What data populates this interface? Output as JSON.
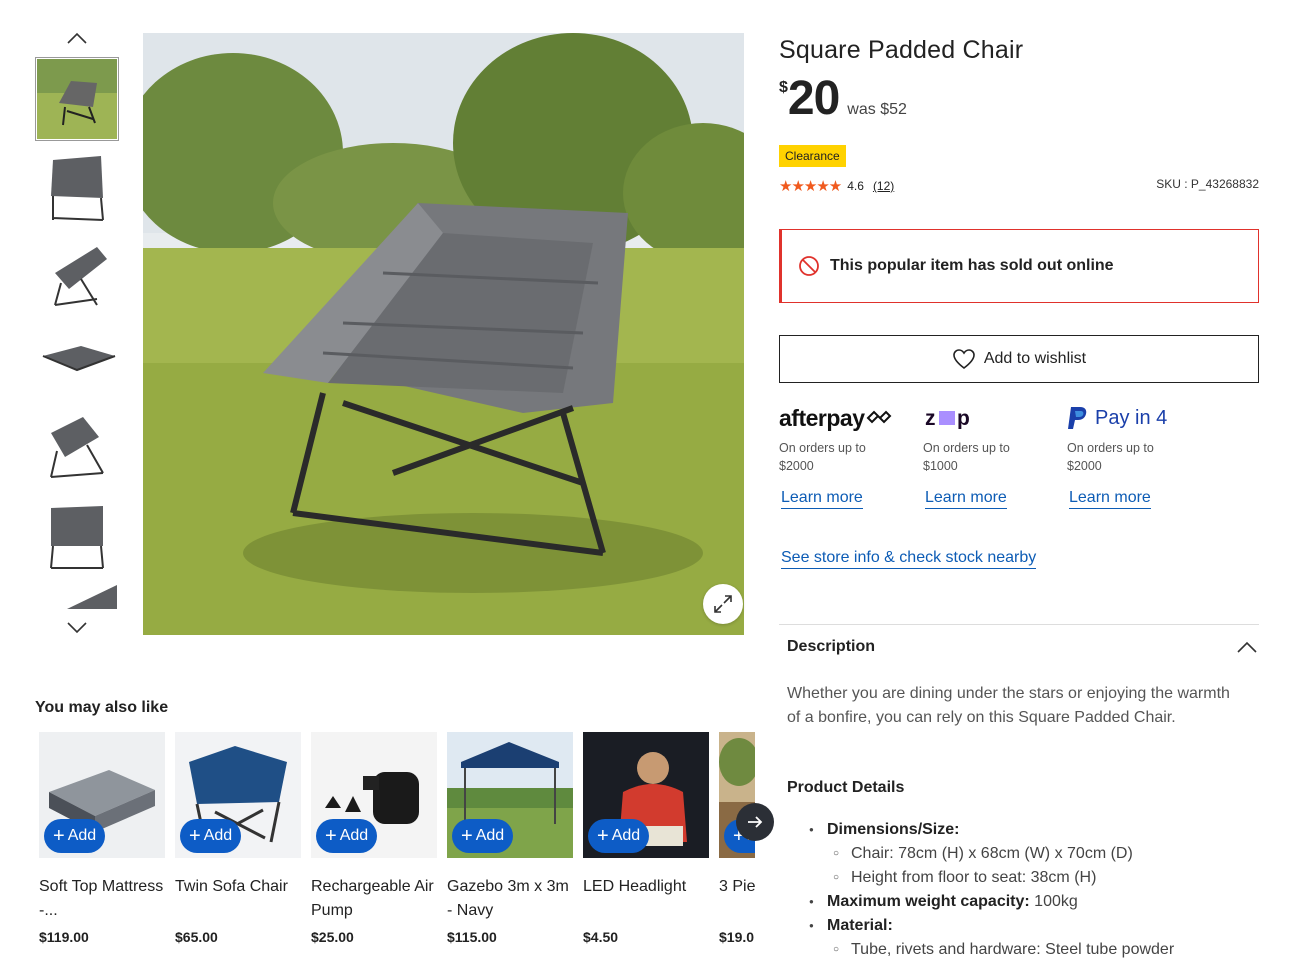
{
  "product": {
    "title": "Square Padded Chair",
    "currency": "$",
    "price": "20",
    "was_price": "was $52",
    "badge": "Clearance",
    "rating": "4.6",
    "review_count": "(12)",
    "stars": "★★★★★",
    "sku": "SKU : P_43268832"
  },
  "stock_notice": {
    "text": "This popular item has sold out online",
    "icon": "no-entry-icon",
    "color": "#e0322c"
  },
  "wishlist": {
    "label": "Add to wishlist",
    "icon": "heart-icon"
  },
  "payments": [
    {
      "name": "afterpay",
      "logo_text": "afterpay",
      "sub1": "On orders up to",
      "sub2": "$2000",
      "link": "Learn more"
    },
    {
      "name": "zip",
      "logo_text": "zip",
      "sub1": "On orders up to",
      "sub2": "$1000",
      "link": "Learn more"
    },
    {
      "name": "paypal",
      "logo_text": "Pay in 4",
      "sub1": "On orders up to",
      "sub2": "$2000",
      "link": "Learn more"
    }
  ],
  "store_link": "See store info & check stock nearby",
  "description": {
    "heading": "Description",
    "text": "Whether you are dining under the stars or enjoying the warmth of a bonfire, you can rely on this Square Padded Chair.",
    "details_heading": "Product Details",
    "dimensions_label": "Dimensions/Size:",
    "dim_chair": "Chair: 78cm (H) x 68cm (W) x 70cm (D)",
    "dim_seat": "Height from floor to seat: 38cm (H)",
    "weight_label": "Maximum weight capacity:",
    "weight_value": " 100kg",
    "material_label": "Material:",
    "material_tube": "Tube, rivets and hardware: Steel tube powder"
  },
  "recommendations": {
    "heading": "You may also like",
    "add_label": "Add",
    "items": [
      {
        "name": "Soft Top Mattress -...",
        "price": "$119.00"
      },
      {
        "name": "Twin Sofa Chair",
        "price": "$65.00"
      },
      {
        "name": "Rechargeable Air Pump",
        "price": "$25.00"
      },
      {
        "name": "Gazebo 3m x 3m - Navy",
        "price": "$115.00"
      },
      {
        "name": "LED Headlight",
        "price": "$4.50"
      },
      {
        "name": "3 Pie",
        "price": "$19.0"
      }
    ]
  },
  "colors": {
    "accent": "#0d5cb5",
    "add_button": "#0d5cc6",
    "badge": "#ffd200",
    "stars": "#f05a1e"
  }
}
